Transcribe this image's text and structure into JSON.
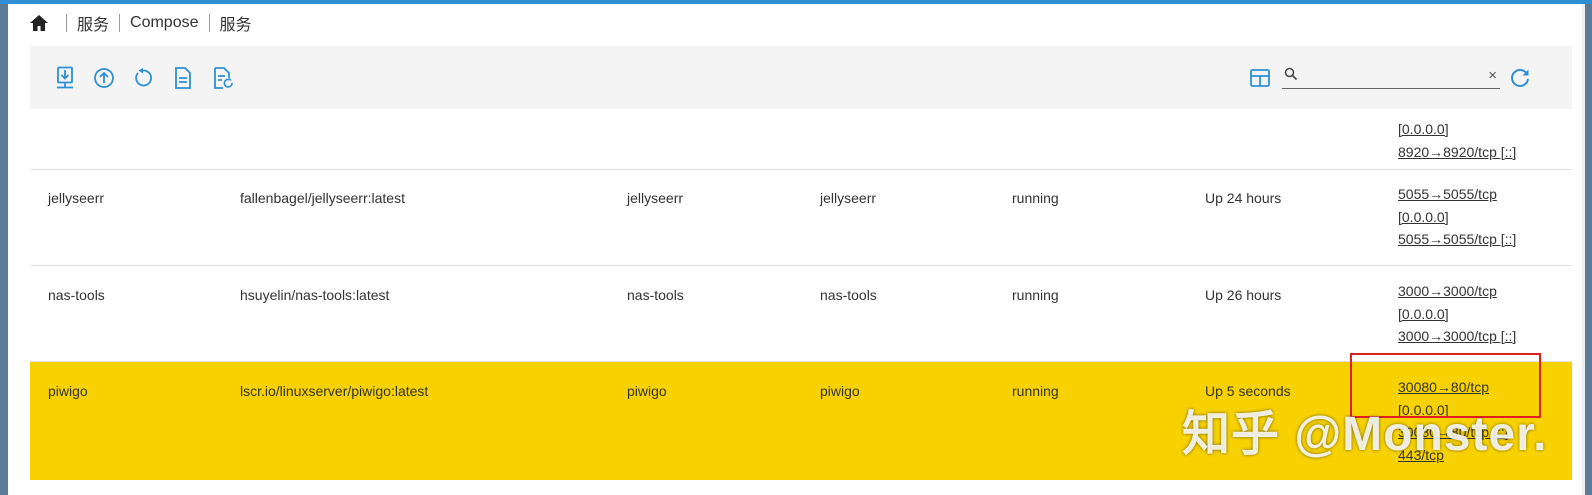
{
  "breadcrumb": {
    "items": [
      "服务",
      "Compose",
      "服务"
    ]
  },
  "toolbar": {
    "buttons": [
      {
        "icon": "download-icon"
      },
      {
        "icon": "upload-icon"
      },
      {
        "icon": "restart-icon"
      },
      {
        "icon": "document-icon"
      },
      {
        "icon": "document-refresh-icon"
      }
    ],
    "search": {
      "value": "",
      "placeholder": ""
    },
    "clear_label": "×"
  },
  "colors": {
    "accent": "#2f8fd4",
    "icon_blue": "#2d8fd5",
    "selected_row": "#f7d200",
    "highlight_box": "#e02020"
  },
  "services": [
    {
      "name": "",
      "image": "",
      "service": "",
      "container": "",
      "state": "",
      "status": "",
      "ports": [
        "[0.0.0.0]",
        "8920→8920/tcp [::]"
      ]
    },
    {
      "name": "jellyseerr",
      "image": "fallenbagel/jellyseerr:latest",
      "service": "jellyseerr",
      "container": "jellyseerr",
      "state": "running",
      "status": "Up 24 hours",
      "ports": [
        "5055→5055/tcp",
        "[0.0.0.0]",
        "5055→5055/tcp [::]"
      ]
    },
    {
      "name": "nas-tools",
      "image": "hsuyelin/nas-tools:latest",
      "service": "nas-tools",
      "container": "nas-tools",
      "state": "running",
      "status": "Up 26 hours",
      "ports": [
        "3000→3000/tcp",
        "[0.0.0.0]",
        "3000→3000/tcp [::]"
      ]
    },
    {
      "name": "piwigo",
      "image": "lscr.io/linuxserver/piwigo:latest",
      "service": "piwigo",
      "container": "piwigo",
      "state": "running",
      "status": "Up 5 seconds",
      "ports": [
        "30080→80/tcp",
        "[0.0.0.0]",
        "30080→80/tcp [::]",
        "443/tcp"
      ]
    }
  ],
  "watermark": "知乎 @Monster."
}
